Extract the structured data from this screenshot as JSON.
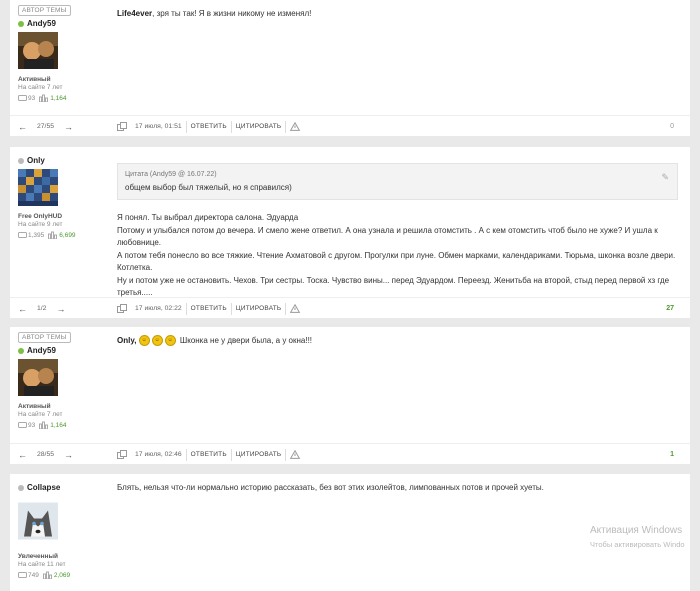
{
  "posts": [
    {
      "badge": "АВТОР ТЕМЫ",
      "username": "Andy59",
      "online": true,
      "role": "Активный",
      "since": "На сайте 7 лет",
      "stat_posts": "93",
      "stat_rating": "1,164",
      "author_tag": "Life4ever",
      "text": ", зря ты так! Я в жизни никому не изменял!",
      "pagination": "27/55",
      "date": "17 июля, 01:51",
      "reply": "ОТВЕТИТЬ",
      "quote_btn": "ЦИТИРОВАТЬ",
      "count": "0"
    },
    {
      "username": "Only",
      "online": false,
      "role": "Free OnlyHUD",
      "since": "На сайте 9 лет",
      "stat_posts": "1,395",
      "stat_rating": "6,699",
      "quote_header": "Цитата (Andy59 @ 16.07.22)",
      "quote_text": "общем выбор был тяжелый, но я справился)",
      "lines": [
        "Я понял. Ты выбрал  директора салона. Эдуарда",
        "Потому и улыбался потом до вечера. И смело жене ответил. А она узнала и решила отомстить . А с кем отомстить чтоб было не хуже? И  ушла к любовнице.",
        "А потом тебя понесло во все тяжкие. Чтение Ахматовой с другом. Прогулки при луне. Обмен марками, календариками. Тюрьма, шконка возле двери. Котлетка.",
        "Ну и потом уже не остановить. Чехов. Три сестры. Тоска. Чувство вины... перед Эдуардом. Переезд. Женитьба на второй, стыд перед первой хз где третья....."
      ],
      "pagination": "1/2",
      "date": "17 июля, 02:22",
      "reply": "ОТВЕТИТЬ",
      "quote_btn": "ЦИТИРОВАТЬ",
      "count": "27"
    },
    {
      "badge": "АВТОР ТЕМЫ",
      "username": "Andy59",
      "online": true,
      "role": "Активный",
      "since": "На сайте 7 лет",
      "stat_posts": "93",
      "stat_rating": "1,164",
      "author_tag": "Only",
      "text": " Шконка не у двери была, а у окна!!!",
      "pagination": "28/55",
      "date": "17 июля, 02:46",
      "reply": "ОТВЕТИТЬ",
      "quote_btn": "ЦИТИРОВАТЬ",
      "count": "1"
    },
    {
      "username": "Collapse",
      "online": false,
      "role": "Увлеченный",
      "since": "На сайте 11 лет",
      "stat_posts": "749",
      "stat_rating": "2,069",
      "text": "Блять, нельзя что-ли нормально историю рассказать, без вот этих изолейтов, лимпованных потов и прочей хуеты."
    }
  ],
  "watermark": {
    "title": "Активация Windows",
    "subtitle": "Чтобы активировать Windo"
  }
}
